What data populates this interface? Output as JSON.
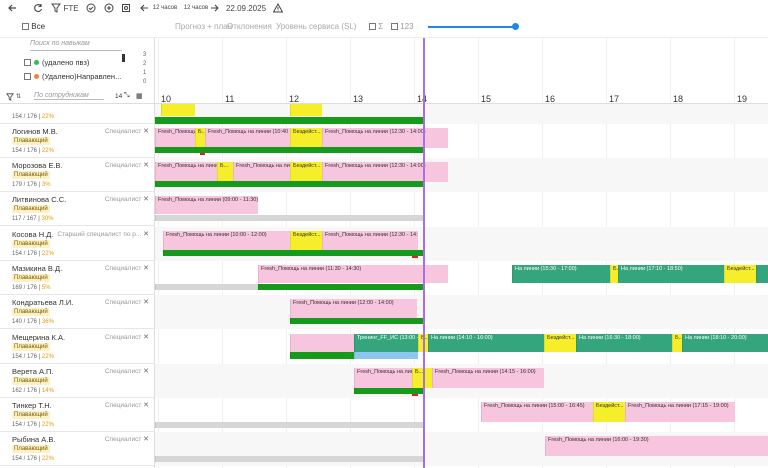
{
  "toolbar": {
    "fte_label": "FTE",
    "range_left": "12 часов",
    "range_right": "12 часов",
    "date": "22.09.2025"
  },
  "filters": {
    "all_label": "Все",
    "forecast_plan": "Прогноз + план",
    "deviations": "Отклонения",
    "service_level": "Уровень сервиса (SL)",
    "sigma_label": "Σ",
    "count_label": "123"
  },
  "skills": {
    "search_placeholder": "Поиск по навыкам",
    "items": [
      {
        "label": "(удалено пвз)",
        "color": "#2ebd59"
      },
      {
        "label": "(Удалено)Направлен...",
        "color": "#e08a3c"
      }
    ],
    "mini_axis": [
      "3",
      "2",
      "1",
      "0"
    ]
  },
  "employees_header": {
    "search_placeholder": "По сотрудникам",
    "count": "14"
  },
  "hours": [
    "10",
    "11",
    "12",
    "13",
    "14",
    "15",
    "16",
    "17",
    "18",
    "19"
  ],
  "employees": [
    {
      "name": "",
      "role": "",
      "badge": "",
      "stat": "154 / 176 |",
      "pct": "22%"
    },
    {
      "name": "Логинов М.В.",
      "role": "Специалист",
      "badge": "Плавающий",
      "stat": "154 / 176 |",
      "pct": "22%"
    },
    {
      "name": "Морозова Е.В.",
      "role": "Специалист",
      "badge": "Плавающий",
      "stat": "179 / 176 |",
      "pct": "3%"
    },
    {
      "name": "Литвинова С.С.",
      "role": "Специалист",
      "badge": "Плавающий",
      "stat": "117 / 167 |",
      "pct": "30%"
    },
    {
      "name": "Косова Н.Д.",
      "role": "Старший специалист по р...",
      "badge": "Плавающий",
      "stat": "154 / 176 |",
      "pct": "22%"
    },
    {
      "name": "Мазикина В.Д.",
      "role": "Специалист",
      "badge": "Плавающий",
      "stat": "169 / 176 |",
      "pct": "5%"
    },
    {
      "name": "Кондратьева Л.И.",
      "role": "Специалист",
      "badge": "Плавающий",
      "stat": "140 / 176 |",
      "pct": "36%"
    },
    {
      "name": "Мещерина К.А.",
      "role": "Специалист",
      "badge": "Плавающий",
      "stat": "154 / 176 |",
      "pct": "22%"
    },
    {
      "name": "Веретa А.П.",
      "role": "Специалист",
      "badge": "Плавающий",
      "stat": "162 / 176 |",
      "pct": "14%"
    },
    {
      "name": "Тинкер Т.Н.",
      "role": "Специалист",
      "badge": "Плавающий",
      "stat": "154 / 176 |",
      "pct": "22%"
    },
    {
      "name": "Рыбина А.В.",
      "role": "Специалист",
      "badge": "Плавающий",
      "stat": "154 / 176 |",
      "pct": "22%"
    }
  ],
  "shifts": {
    "r1_a": "Fresh_Помощь на линии (09:00 - 10...",
    "r1_b": "Б...",
    "r1_c": "Fresh_Помощь на линии (10:40 - ...",
    "r1_d": "Бездейст...",
    "r1_e": "Fresh_Помощь на линии (12:30 - 14:00)",
    "r2_a": "Fresh_Помощь на линии (09:00 - 10:50)",
    "r2_b": "Б...",
    "r2_c": "Fresh_Помощь на линии (11:10 - 12:...",
    "r2_d": "Бездейст...",
    "r2_e": "Fresh_Помощь на линии (12:30 - 14:00)",
    "r3_a": "Fresh_Помощь на линии (09:00 - 11:30)",
    "r4_a": "Fresh_Помощь на линии (10:00 - 12:00)",
    "r4_b": "Бездейст...",
    "r4_c": "Fresh_Помощь на линии (12:30 - 14:...",
    "r5_a": "Fresh_Помощь на линии (11:30 - 14:30)",
    "r5_b": "На линии (15:30 - 17:00)",
    "r5_c": "Б...",
    "r5_d": "На линии (17:10 - 18:50)",
    "r5_e": "Бездейст...",
    "r6_a": "Fresh_Помощь на линии (12:00 - 14:00)",
    "r7_a": "Тренинг_FF_ИС (13:00 - 14:...",
    "r7_b": "Б...",
    "r7_c": "На линии (14:10 - 16:00)",
    "r7_d": "Бездейст...",
    "r7_e": "На линии (16:30 - 18:00)",
    "r7_f": "Б...",
    "r7_g": "На линии (18:10 - 20:00)",
    "r8_a": "Fresh_Помощь на линии...",
    "r8_b": "Б...",
    "r8_c": "Fresh_Помощь на линии (14:15 - 16:00)",
    "r9_a": "Fresh_Помощь на линии (15:00 - 16:45)",
    "r9_b": "Бездейст...",
    "r9_c": "Fresh_Помощь на линии (17:15 - 19:00)",
    "r10_a": "Fresh_Помощь на линии (16:00 - 19:30)"
  }
}
